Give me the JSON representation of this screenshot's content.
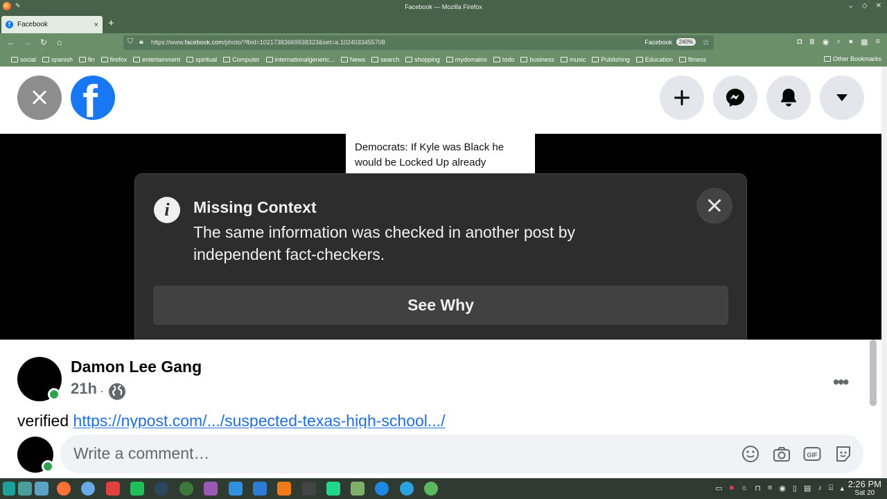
{
  "window": {
    "title": "Facebook — Mozilla Firefox"
  },
  "tab": {
    "label": "Facebook",
    "close": "×",
    "new_tab": "+"
  },
  "nav": {
    "back": "←",
    "forward": "→",
    "reload": "↻",
    "home": "⌂"
  },
  "urlbar": {
    "url_prefix": "https://www.",
    "url_host": "facebook.com",
    "url_path": "/photo/?fbid=10217383669938323&set=a.1024033455708",
    "site_label": "Facebook",
    "zoom": "240%"
  },
  "bookmarks": [
    "social",
    "spanish",
    "fin",
    "firefox",
    "entertainment",
    "spiritual",
    "Computer",
    "internationalgeneric...",
    "News",
    "search",
    "shopping",
    "mydomains",
    "todo",
    "business",
    "music",
    "Publishing",
    "Education",
    "fitness"
  ],
  "other_bookmarks": "Other Bookmarks",
  "photo": {
    "caption": "Democrats: If Kyle was Black he would be Locked Up already"
  },
  "warning": {
    "title": "Missing Context",
    "text": "The same information was checked in another post by independent fact-checkers.",
    "button": "See Why"
  },
  "post": {
    "author": "Damon Lee Gang",
    "time": "21h",
    "separator": "·",
    "more": "•••",
    "text_prefix": "verified ",
    "link": "https://nypost.com/.../suspected-texas-high-school.../"
  },
  "comment": {
    "placeholder": "Write a comment…"
  },
  "clock": {
    "time": "2:26 PM",
    "date": "Sat 20"
  },
  "colors": {
    "fb_blue": "#1877f2",
    "online_green": "#31a24c",
    "link_blue": "#216fdb",
    "firefox_theme": "#6b8f68"
  }
}
